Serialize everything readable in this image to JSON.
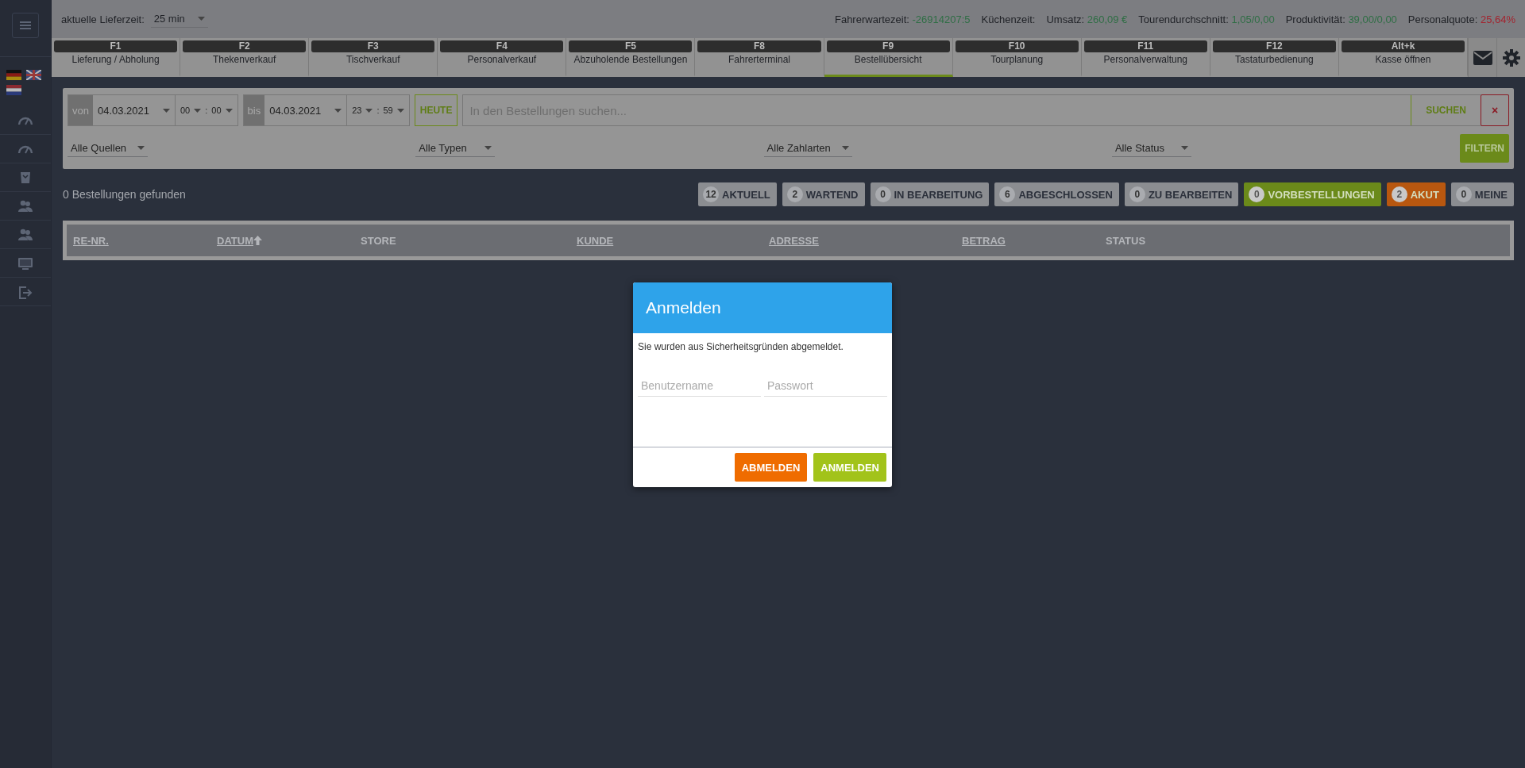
{
  "top_bar": {
    "delivery_time": {
      "label": "aktuelle Lieferzeit:",
      "value": "25 min"
    },
    "stats": [
      {
        "label": "Fahrerwartezeit:",
        "value": "-26914207:5",
        "color": "#2f6e45"
      },
      {
        "label": "Küchenzeit:"
      },
      {
        "label": "Umsatz:",
        "value": "260,09 €",
        "color": "#2f6e45"
      },
      {
        "label": "Tourendurchschnitt:",
        "value": "1,05/0,00",
        "color": "#2f6e45"
      },
      {
        "label": "Produktivität:",
        "value": "39,00/0,00",
        "color": "#2f6e45"
      },
      {
        "label": "Personalquote:",
        "value": "25,64%",
        "color": "#a3242f"
      }
    ]
  },
  "tabs": [
    {
      "key": "F1",
      "label": "Lieferung / Abholung",
      "selected": false
    },
    {
      "key": "F2",
      "label": "Thekenverkauf",
      "selected": false
    },
    {
      "key": "F3",
      "label": "Tischverkauf",
      "selected": false
    },
    {
      "key": "F4",
      "label": "Personalverkauf",
      "selected": false
    },
    {
      "key": "F5",
      "label": "Abzuholende Bestellungen",
      "selected": false
    },
    {
      "key": "F8",
      "label": "Fahrerterminal",
      "selected": false
    },
    {
      "key": "F9",
      "label": "Bestellübersicht",
      "selected": true
    },
    {
      "key": "F10",
      "label": "Tourplanung",
      "selected": false
    },
    {
      "key": "F11",
      "label": "Personalverwaltung",
      "selected": false
    },
    {
      "key": "F12",
      "label": "Tastaturbedienung",
      "selected": false
    },
    {
      "key": "Alt+k",
      "label": "Kasse öffnen",
      "selected": false
    }
  ],
  "filter": {
    "from": {
      "label": "von",
      "date": "04.03.2021",
      "hour": "00",
      "minute": "00"
    },
    "to": {
      "label": "bis",
      "date": "04.03.2021",
      "hour": "23",
      "minute": "59"
    },
    "time_separator": ":",
    "today_button": "HEUTE",
    "search": {
      "placeholder": "In den Bestellungen suchen..."
    },
    "search_button": "SUCHEN",
    "clear_button": "×",
    "dropdowns": [
      "Alle Quellen",
      "Alle Typen",
      "Alle Zahlarten",
      "Alle Status"
    ],
    "filter_button": "FILTERN"
  },
  "result_count": "0 Bestellungen gefunden",
  "status_buttons": [
    {
      "count": "12",
      "label": "AKTUELL",
      "color": "#8b8d91"
    },
    {
      "count": "2",
      "label": "WARTEND",
      "color": "#8b8d91"
    },
    {
      "count": "0",
      "label": "IN BEARBEITUNG",
      "color": "#8b8d91"
    },
    {
      "count": "6",
      "label": "ABGESCHLOSSEN",
      "color": "#8b8d91"
    },
    {
      "count": "0",
      "label": "ZU BEARBEITEN",
      "color": "#8b8d91"
    },
    {
      "count": "0",
      "label": "VORBESTELLUNGEN",
      "color": "#6b8a1a"
    },
    {
      "count": "2",
      "label": "AKUT",
      "color": "#b8570f"
    },
    {
      "count": "0",
      "label": "MEINE",
      "color": "#8b8d91"
    }
  ],
  "table": {
    "columns": [
      {
        "label": "RE-NR.",
        "sortable": true,
        "sorted_ascending": false
      },
      {
        "label": "DATUM",
        "sortable": true,
        "sorted_ascending": true
      },
      {
        "label": "STORE",
        "sortable": false,
        "sorted_ascending": false
      },
      {
        "label": "KUNDE",
        "sortable": true,
        "sorted_ascending": false
      },
      {
        "label": "ADRESSE",
        "sortable": true,
        "sorted_ascending": false
      },
      {
        "label": "BETRAG",
        "sortable": true,
        "sorted_ascending": false
      },
      {
        "label": "STATUS",
        "sortable": false,
        "sorted_ascending": false
      }
    ]
  },
  "dialog": {
    "title": "Anmelden",
    "message": "Sie wurden aus Sicherheitsgründen abgemeldet.",
    "fields": [
      {
        "placeholder": "Benutzername"
      },
      {
        "placeholder": "Passwort"
      }
    ],
    "buttons": [
      {
        "label": "ABMELDEN",
        "kind": "secondary"
      },
      {
        "label": "ANMELDEN",
        "kind": "primary"
      }
    ]
  }
}
